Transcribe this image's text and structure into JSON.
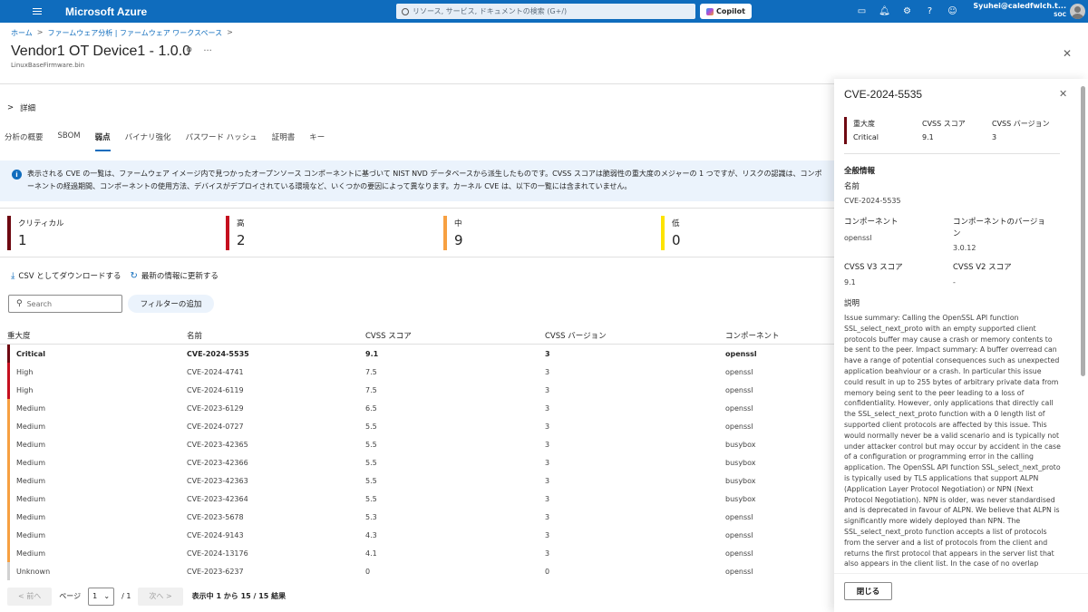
{
  "topbar": {
    "brand": "Microsoft Azure",
    "search_placeholder": "リソース, サービス, ドキュメントの検索 (G+/)",
    "copilot_label": "Copilot",
    "user_email": "Syuhei@caledfwlch.t...",
    "user_tenant": "SOC"
  },
  "breadcrumb": [
    "ホーム",
    "ファームウェア分析 | ファームウェア ワークスペース"
  ],
  "page": {
    "title": "Vendor1 OT Device1 - 1.0.0",
    "subtitle": "LinuxBaseFirmware.bin",
    "details_label": "詳細"
  },
  "tabs": [
    {
      "label": "分析の概要",
      "active": false
    },
    {
      "label": "SBOM",
      "active": false
    },
    {
      "label": "弱点",
      "active": true
    },
    {
      "label": "バイナリ強化",
      "active": false
    },
    {
      "label": "パスワード ハッシュ",
      "active": false
    },
    {
      "label": "証明書",
      "active": false
    },
    {
      "label": "キー",
      "active": false
    }
  ],
  "info_text": "表示される CVE の一覧は、ファームウェア イメージ内で見つかったオープンソース コンポーネントに基づいて NIST NVD データベースから派生したものです。CVSS スコアは脆弱性の重大度のメジャーの 1 つですが、リスクの認識は、コンポーネントの経過期間、コンポーネントの使用方法、デバイスがデプロイされている環境など、いくつかの要因によって異なります。カーネル CVE は、以下の一覧には含まれていません。",
  "severity_summary": [
    {
      "label": "クリティカル",
      "count": "1",
      "color": "#6e0811"
    },
    {
      "label": "高",
      "count": "2",
      "color": "#c50f1f"
    },
    {
      "label": "中",
      "count": "9",
      "color": "#f7a041"
    },
    {
      "label": "低",
      "count": "0",
      "color": "#fde300"
    }
  ],
  "actions": {
    "download": "CSV としてダウンロードする",
    "refresh": "最新の情報に更新する"
  },
  "search": {
    "placeholder": "Search"
  },
  "filter_label": "フィルターの追加",
  "table": {
    "headers": [
      "重大度",
      "名前",
      "CVSS スコア",
      "CVSS バージョン",
      "コンポーネント"
    ],
    "rows": [
      {
        "severity": "Critical",
        "name": "CVE-2024-5535",
        "score": "9.1",
        "version": "3",
        "component": "openssl",
        "color": "#6e0811"
      },
      {
        "severity": "High",
        "name": "CVE-2024-4741",
        "score": "7.5",
        "version": "3",
        "component": "openssl",
        "color": "#c50f1f"
      },
      {
        "severity": "High",
        "name": "CVE-2024-6119",
        "score": "7.5",
        "version": "3",
        "component": "openssl",
        "color": "#c50f1f"
      },
      {
        "severity": "Medium",
        "name": "CVE-2023-6129",
        "score": "6.5",
        "version": "3",
        "component": "openssl",
        "color": "#f7a041"
      },
      {
        "severity": "Medium",
        "name": "CVE-2024-0727",
        "score": "5.5",
        "version": "3",
        "component": "openssl",
        "color": "#f7a041"
      },
      {
        "severity": "Medium",
        "name": "CVE-2023-42365",
        "score": "5.5",
        "version": "3",
        "component": "busybox",
        "color": "#f7a041"
      },
      {
        "severity": "Medium",
        "name": "CVE-2023-42366",
        "score": "5.5",
        "version": "3",
        "component": "busybox",
        "color": "#f7a041"
      },
      {
        "severity": "Medium",
        "name": "CVE-2023-42363",
        "score": "5.5",
        "version": "3",
        "component": "busybox",
        "color": "#f7a041"
      },
      {
        "severity": "Medium",
        "name": "CVE-2023-42364",
        "score": "5.5",
        "version": "3",
        "component": "busybox",
        "color": "#f7a041"
      },
      {
        "severity": "Medium",
        "name": "CVE-2023-5678",
        "score": "5.3",
        "version": "3",
        "component": "openssl",
        "color": "#f7a041"
      },
      {
        "severity": "Medium",
        "name": "CVE-2024-9143",
        "score": "4.3",
        "version": "3",
        "component": "openssl",
        "color": "#f7a041"
      },
      {
        "severity": "Medium",
        "name": "CVE-2024-13176",
        "score": "4.1",
        "version": "3",
        "component": "openssl",
        "color": "#f7a041"
      },
      {
        "severity": "Unknown",
        "name": "CVE-2023-6237",
        "score": "0",
        "version": "0",
        "component": "openssl",
        "color": "#d1d1d1"
      }
    ]
  },
  "pager": {
    "prev": "< 前へ",
    "page_label": "ページ",
    "page_value": "1",
    "total_pages": "/ 1",
    "next": "次へ >",
    "count_text": "表示中 1 から 15 / 15 結果"
  },
  "panel": {
    "title": "CVE-2024-5535",
    "severity_label": "重大度",
    "severity_value": "Critical",
    "score_label": "CVSS スコア",
    "score_value": "9.1",
    "version_label": "CVSS バージョン",
    "version_value": "3",
    "general_heading": "全般情報",
    "name_label": "名前",
    "name_value": "CVE-2024-5535",
    "component_label": "コンポーネント",
    "component_value": "openssl",
    "component_version_label": "コンポーネントのバージョン",
    "component_version_value": "3.0.12",
    "v3_label": "CVSS V3 スコア",
    "v3_value": "9.1",
    "v2_label": "CVSS V2 スコア",
    "v2_value": "-",
    "desc_label": "説明",
    "description": "Issue summary: Calling the OpenSSL API function SSL_select_next_proto with an empty supported client protocols buffer may cause a crash or memory contents to be sent to the peer. Impact summary: A buffer overread can have a range of potential consequences such as unexpected application beahviour or a crash. In particular this issue could result in up to 255 bytes of arbitrary private data from memory being sent to the peer leading to a loss of confidentiality. However, only applications that directly call the SSL_select_next_proto function with a 0 length list of supported client protocols are affected by this issue. This would normally never be a valid scenario and is typically not under attacker control but may occur by accident in the case of a configuration or programming error in the calling application. The OpenSSL API function SSL_select_next_proto is typically used by TLS applications that support ALPN (Application Layer Protocol Negotiation) or NPN (Next Protocol Negotiation). NPN is older, was never standardised and is deprecated in favour of ALPN. We believe that ALPN is significantly more widely deployed than NPN. The SSL_select_next_proto function accepts a list of protocols from the server and a list of protocols from the client and returns the first protocol that appears in the server list that also appears in the client list. In the case of no overlap",
    "close_label": "閉じる"
  }
}
